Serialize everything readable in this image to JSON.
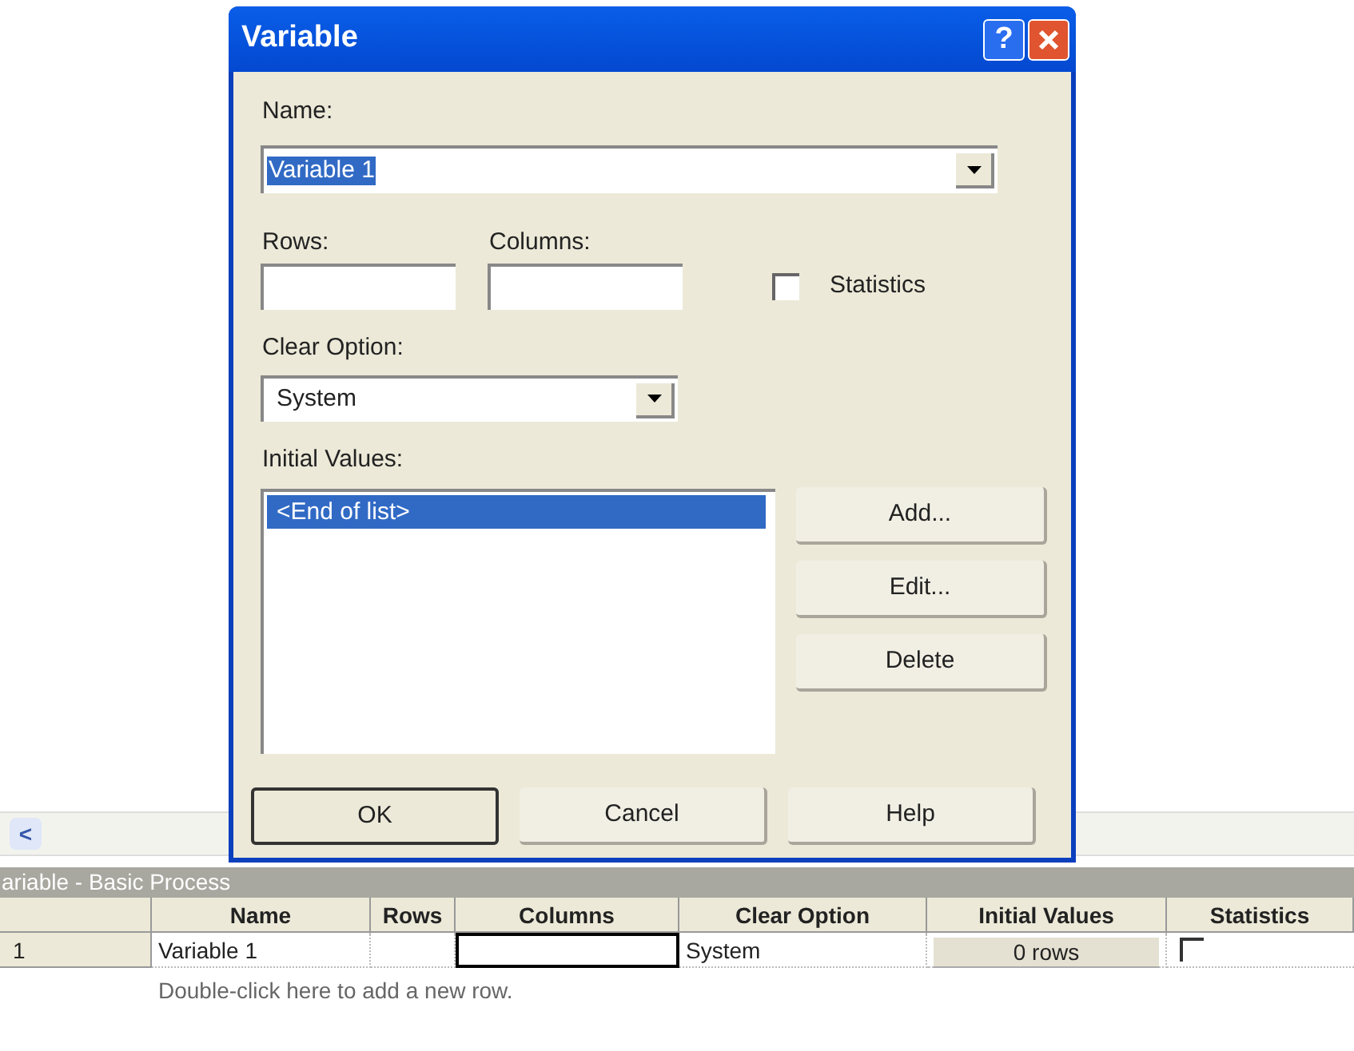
{
  "dialog": {
    "title": "Variable",
    "help_glyph": "?",
    "name_label": "Name:",
    "name_value": "Variable 1",
    "rows_label": "Rows:",
    "columns_label": "Columns:",
    "statistics": {
      "label": "Statistics",
      "checked": false
    },
    "clear_option_label": "Clear Option:",
    "clear_option_value": "System",
    "initial_values_label": "Initial Values:",
    "initial_values": [
      {
        "text": "<End of list>",
        "selected": true
      }
    ],
    "side_buttons": [
      "Add...",
      "Edit...",
      "Delete"
    ],
    "buttons": [
      {
        "label": "OK",
        "default": true
      },
      {
        "label": "Cancel",
        "default": false
      },
      {
        "label": "Help",
        "default": false
      }
    ]
  },
  "scroll_left_glyph": "<",
  "panel_title": "ariable - Basic Process",
  "table": {
    "columns": [
      "Name",
      "Rows",
      "Columns",
      "Clear Option",
      "Initial Values",
      "Statistics"
    ],
    "rows": [
      {
        "number": "1",
        "name": "Variable 1",
        "clear_option": "System",
        "initial_values": "0 rows",
        "statistics": false
      }
    ],
    "add_hint": "Double-click here to add a new row."
  }
}
